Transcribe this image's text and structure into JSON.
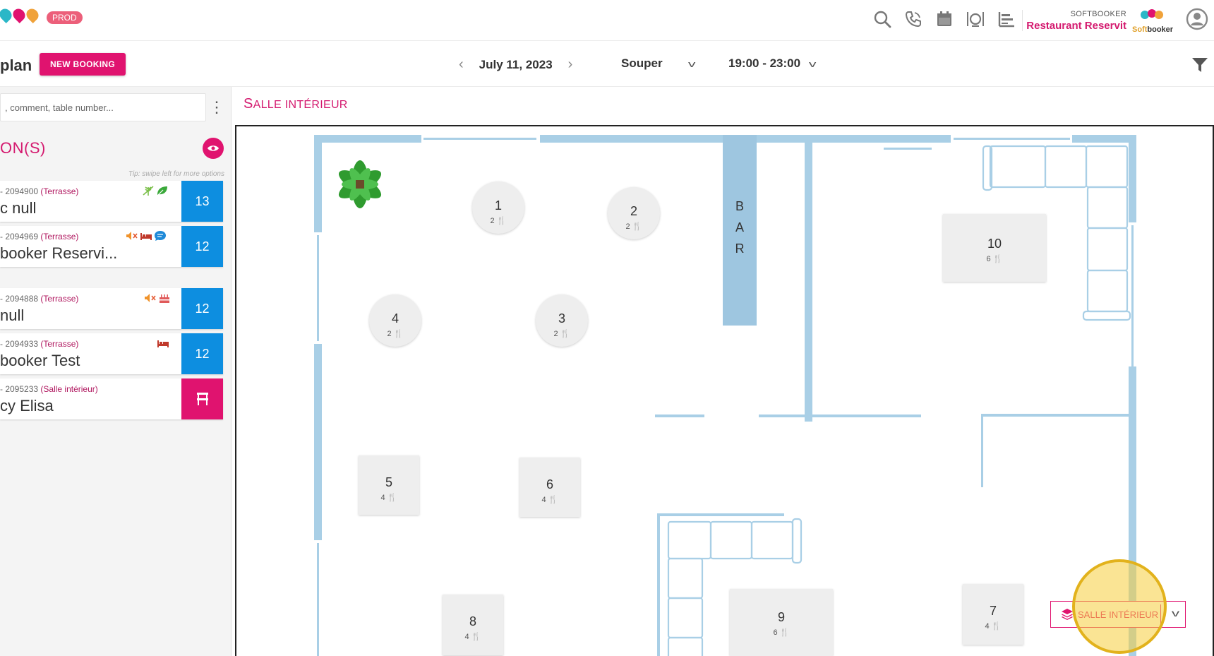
{
  "header": {
    "env_badge": "PROD",
    "restaurant_sub": "SOFTBOOKER",
    "restaurant_name": "Restaurant Reservit",
    "brand_text_a": "Soft",
    "brand_text_b": "booker",
    "icons": [
      "search-icon",
      "phone-icon",
      "calendar-icon",
      "dining-icon",
      "chart-icon",
      "user-icon"
    ]
  },
  "toolbar": {
    "title": "plan",
    "new_booking_label": "NEW BOOKING",
    "date": "July 11, 2023",
    "service": "Souper",
    "time_range": "19:00 - 23:00"
  },
  "sidebar": {
    "search_placeholder": ", comment, table number...",
    "section_title": "ON(S)",
    "tip": "Tip: swipe left for more options",
    "bookings": [
      {
        "id": "- 2094900",
        "area": "(Terrasse)",
        "name": "c null",
        "table": "13"
      },
      {
        "id": "- 2094969",
        "area": "(Terrasse)",
        "name": "booker Reservi...",
        "table": "12"
      },
      {
        "id": "- 2094888",
        "area": "(Terrasse)",
        "name": " null",
        "table": "12"
      },
      {
        "id": "- 2094933",
        "area": "(Terrasse)",
        "name": "booker Test",
        "table": "12"
      },
      {
        "id": "- 2095233",
        "area": "(Salle intérieur)",
        "name": "cy Elisa",
        "table": ""
      }
    ]
  },
  "floor": {
    "room_title_first": "S",
    "room_title_rest": "ALLE INTÉRIEUR",
    "bar_letters": [
      "B",
      "A",
      "R"
    ],
    "tables": [
      {
        "num": "1",
        "covers": "2"
      },
      {
        "num": "2",
        "covers": "2"
      },
      {
        "num": "3",
        "covers": "2"
      },
      {
        "num": "4",
        "covers": "2"
      },
      {
        "num": "5",
        "covers": "4"
      },
      {
        "num": "6",
        "covers": "4"
      },
      {
        "num": "7",
        "covers": "4"
      },
      {
        "num": "8",
        "covers": "4"
      },
      {
        "num": "9",
        "covers": "6"
      },
      {
        "num": "10",
        "covers": "6"
      }
    ],
    "zone_label": "SALLE INTÉRIEUR"
  },
  "colors": {
    "brand_pink": "#e0136f",
    "table_blue": "#0d8ee0",
    "wall_blue": "#a9cfe6"
  }
}
